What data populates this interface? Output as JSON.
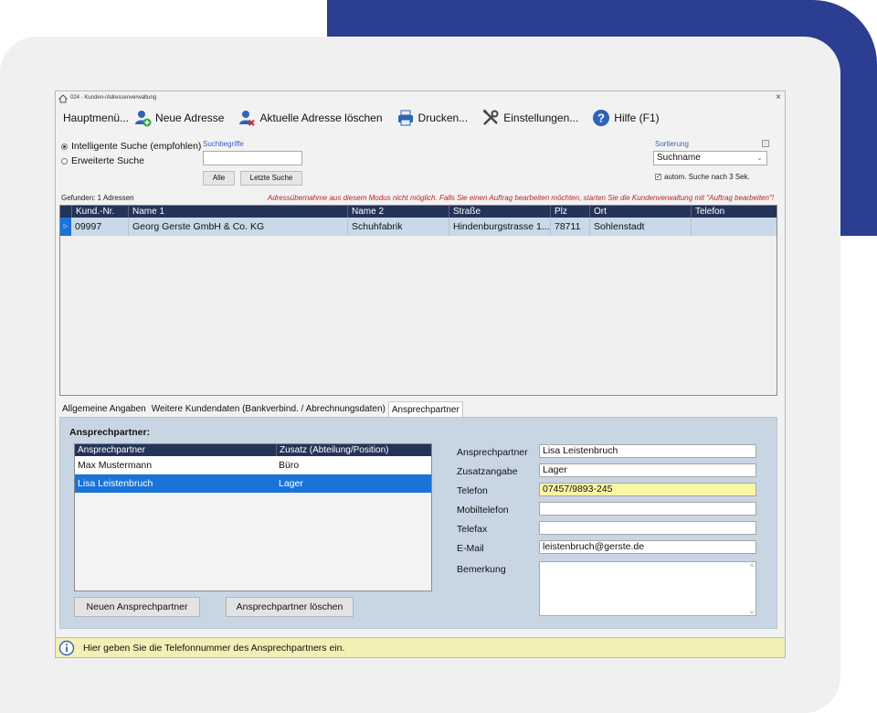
{
  "window": {
    "title": "024 - Kunden-/Adressenverwaltung"
  },
  "toolbar": {
    "main_menu": "Hauptmenü...",
    "new_address": "Neue Adresse",
    "delete_address": "Aktuelle Adresse löschen",
    "print": "Drucken...",
    "settings": "Einstellungen...",
    "help": "Hilfe (F1)"
  },
  "search": {
    "smart_search": "Intelligente Suche (empfohlen)",
    "extended_search": "Erweiterte Suche",
    "terms_label": "Suchbegriffe",
    "terms_value": "",
    "all_button": "Alle",
    "last_search_button": "Letzte Suche",
    "sort_label": "Sortierung",
    "sort_value": "Suchname",
    "auto_search": "autom. Suche nach 3 Sek."
  },
  "results": {
    "found": "Gefunden: 1 Adressen",
    "warning": "Adressübernahme aus diesem Modus nicht möglich. Falls Sie einen Auftrag bearbeiten möchten, starten Sie die Kundenverwaltung mit \"Auftrag bearbeiten\"!",
    "columns": [
      "Kund.-Nr.",
      "Name 1",
      "Name 2",
      "Straße",
      "Plz",
      "Ort",
      "Telefon"
    ],
    "rows": [
      [
        "09997",
        "Georg Gerste GmbH & Co. KG",
        "Schuhfabrik",
        "Hindenburgstrasse 1...",
        "78711",
        "Sohlenstadt",
        ""
      ]
    ]
  },
  "tabs": [
    "Allgemeine Angaben",
    "Weitere Kundendaten (Bankverbind. / Abrechnungsdaten)",
    "Ansprechpartner"
  ],
  "contacts": {
    "title": "Ansprechpartner:",
    "columns": [
      "Ansprechpartner",
      "Zusatz (Abteilung/Position)"
    ],
    "rows": [
      [
        "Max Mustermann",
        "Büro"
      ],
      [
        "Lisa Leistenbruch",
        "Lager"
      ]
    ],
    "new_button": "Neuen Ansprechpartner",
    "delete_button": "Ansprechpartner löschen",
    "fields": {
      "contact_label": "Ansprechpartner",
      "contact_value": "Lisa Leistenbruch",
      "addition_label": "Zusatzangabe",
      "addition_value": "Lager",
      "phone_label": "Telefon",
      "phone_value": "07457/9893-245",
      "mobile_label": "Mobiltelefon",
      "mobile_value": "",
      "fax_label": "Telefax",
      "fax_value": "",
      "email_label": "E-Mail",
      "email_value": "leistenbruch@gerste.de",
      "remark_label": "Bemerkung"
    }
  },
  "status": {
    "message": "Hier geben Sie die Telefonnummer des Ansprechpartners ein."
  },
  "colors": {
    "brand_blue": "#2b3e8f",
    "grid_header": "#243358",
    "selection": "#1a73d8",
    "highlight_field": "#fbf6a4",
    "warning_text": "#c0232b"
  }
}
